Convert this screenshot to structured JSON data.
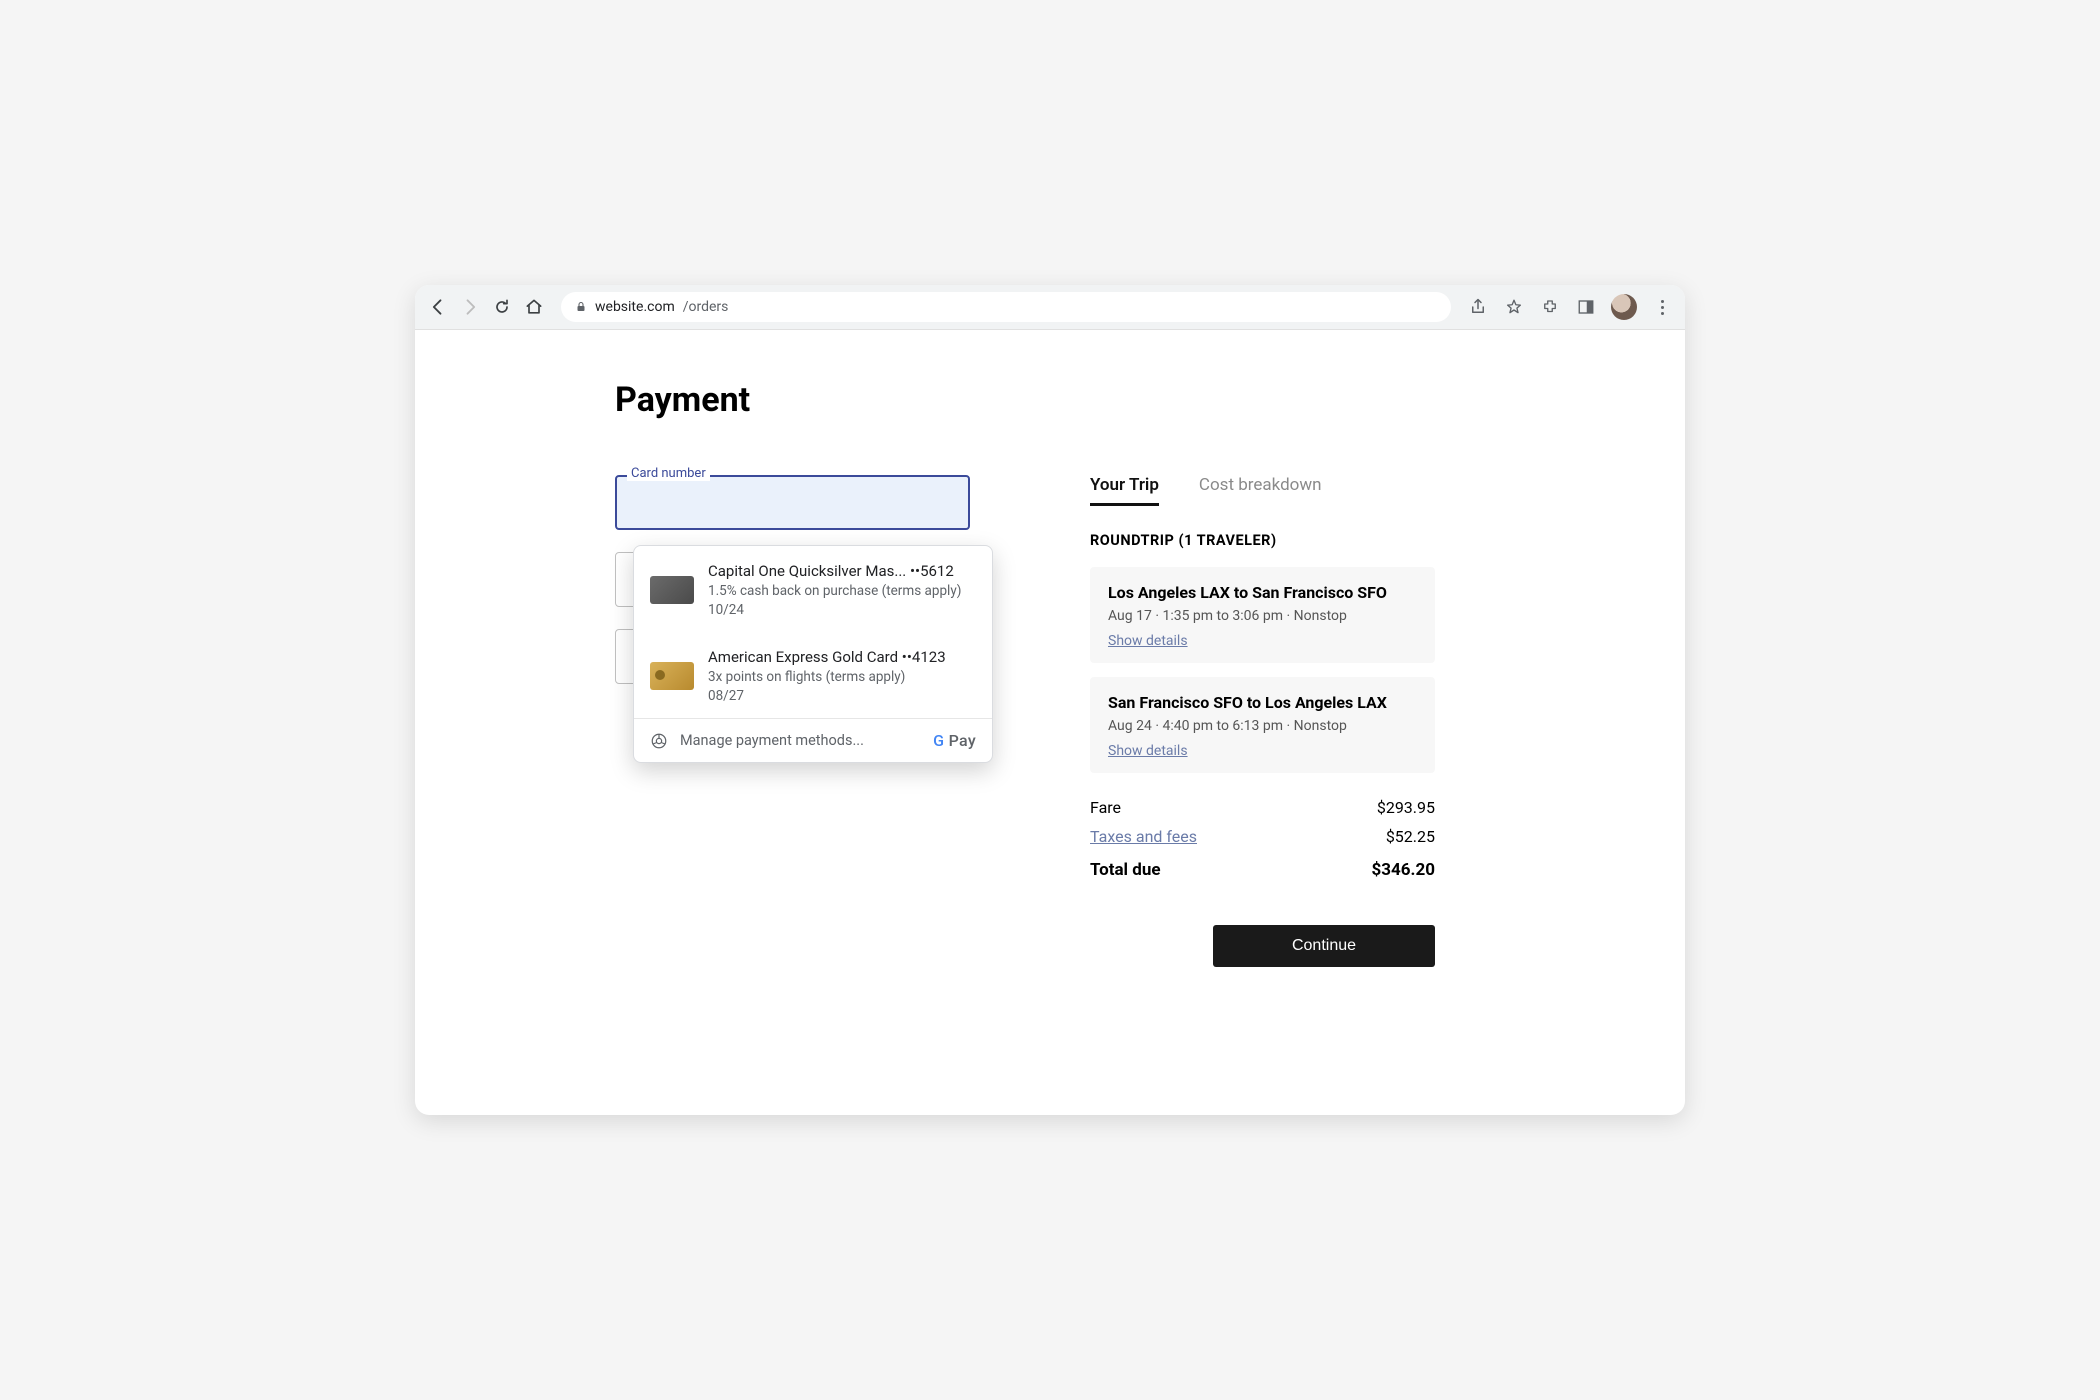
{
  "browser": {
    "url_host": "website.com",
    "url_path": "/orders"
  },
  "page": {
    "title": "Payment"
  },
  "card_field": {
    "label": "Card number",
    "value": ""
  },
  "autofill": {
    "cards": [
      {
        "title": "Capital One Quicksilver Mas... ••5612",
        "subtitle": "1.5% cash back on purchase (terms apply)",
        "expiry": "10/24",
        "art": "grey"
      },
      {
        "title": "American Express Gold Card ••4123",
        "subtitle": "3x points on flights (terms apply)",
        "expiry": "08/27",
        "art": "gold"
      }
    ],
    "manage_label": "Manage payment methods...",
    "brand_pay": "Pay"
  },
  "tabs": {
    "your_trip": "Your Trip",
    "cost_breakdown": "Cost breakdown"
  },
  "trip": {
    "header": "ROUNDTRIP (1 TRAVELER)",
    "flights": [
      {
        "route": "Los Angeles LAX to San Francisco SFO",
        "meta": "Aug 17 · 1:35 pm to 3:06 pm · Nonstop",
        "show": "Show details"
      },
      {
        "route": "San Francisco SFO to Los Angeles LAX",
        "meta": "Aug 24 · 4:40 pm to 6:13 pm · Nonstop",
        "show": "Show details"
      }
    ]
  },
  "pricing": {
    "fare_label": "Fare",
    "fare_value": "$293.95",
    "taxes_label": "Taxes and fees",
    "taxes_value": "$52.25",
    "total_label": "Total due",
    "total_value": "$346.20"
  },
  "continue_label": "Continue"
}
